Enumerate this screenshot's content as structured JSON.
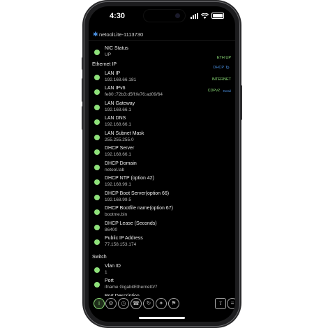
{
  "status": {
    "time": "4:30"
  },
  "device": {
    "name": "netoolLite-1113730"
  },
  "badges": [
    {
      "text": "ETH UP",
      "color": "#8ee07a"
    },
    {
      "text": "DHCP",
      "color": "#4a90e2"
    },
    {
      "text": "INTERNET",
      "color": "#8ee07a"
    },
    {
      "text": "CDPv2",
      "color": "#8ee07a"
    },
    {
      "text": "Detail",
      "color": "#4a90e2"
    }
  ],
  "nic": {
    "label": "NIC Status",
    "value": "UP"
  },
  "sections": {
    "ethernet": "Ethernet IP",
    "switch": "Switch"
  },
  "ethernet_items": [
    {
      "label": "LAN IP",
      "value": "192.168.66.181"
    },
    {
      "label": "LAN IPv6",
      "value": "fe80::72b3:d5ff:fe76:ad09/64"
    },
    {
      "label": "LAN Gateway",
      "value": "192.168.66.1"
    },
    {
      "label": "LAN DNS",
      "value": "192.168.66.1"
    },
    {
      "label": "LAN Subnet Mask",
      "value": "255.255.255.0"
    },
    {
      "label": "DHCP Server",
      "value": "192.168.66.1"
    },
    {
      "label": "DHCP Domain",
      "value": "netool.lab"
    },
    {
      "label": "DHCP NTP (option 42)",
      "value": "192.168.99.1"
    },
    {
      "label": "DHCP Boot Server(option 66)",
      "value": "192.168.99.5"
    },
    {
      "label": "DHCP Bootfile name(option 67)",
      "value": "bootme.bin"
    },
    {
      "label": "DHCP Lease (Seconds)",
      "value": "86400"
    },
    {
      "label": "Public IP Address",
      "value": "77.158.153.174"
    }
  ],
  "switch_items": [
    {
      "label": "Vlan ID",
      "value": "1"
    },
    {
      "label": "Port",
      "value": "ifname GigabitEthernet0/7"
    },
    {
      "label": "Port Description",
      "value": ""
    }
  ],
  "colors": {
    "accent": "#8ee07a",
    "link": "#4a90e2",
    "background": "#000000"
  }
}
